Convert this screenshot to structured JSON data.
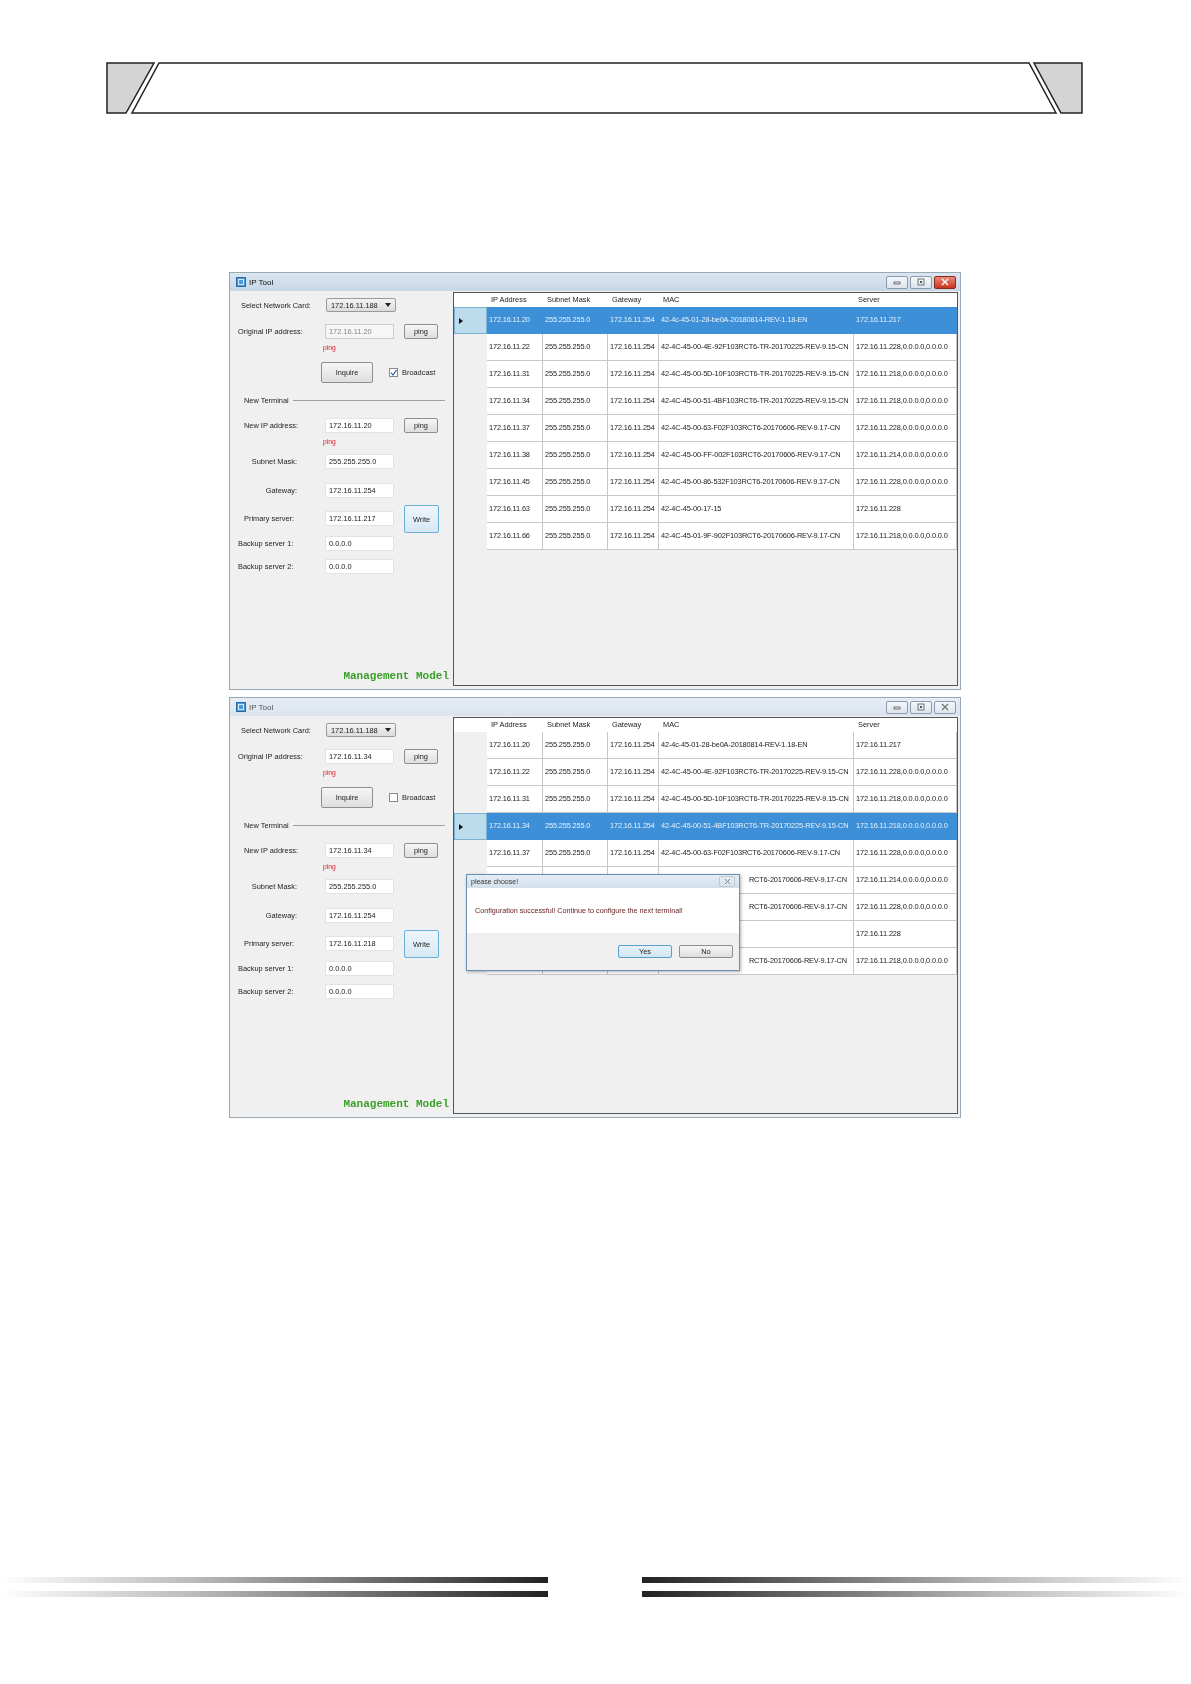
{
  "windows": [
    {
      "title": "IP Tool",
      "active": true,
      "network_card": {
        "label": "Select Network Card:",
        "value": "172.16.11.188"
      },
      "original_ip": {
        "label": "Original IP address:",
        "value": "172.16.11.20",
        "disabled": true,
        "button": "ping",
        "status": "ping"
      },
      "inquire_button": "Inquire",
      "broadcast": {
        "label": "Broadcast",
        "checked": true
      },
      "section_title": "New Terminal",
      "new_ip": {
        "label": "New IP address:",
        "value": "172.16.11.20",
        "button": "ping",
        "status": "ping"
      },
      "subnet": {
        "label": "Subnet Mask:",
        "value": "255.255.255.0"
      },
      "gateway": {
        "label": "Gateway:",
        "value": "172.16.11.254"
      },
      "primary": {
        "label": "Primary server:",
        "value": "172.16.11.217"
      },
      "write_button": "Write",
      "backup_1": {
        "label": "Backup server 1:",
        "value": "0.0.0.0"
      },
      "backup_2": {
        "label": "Backup server 2:",
        "value": "0.0.0.0"
      },
      "mode_label": "Management Model",
      "table": {
        "columns": [
          "IP Address",
          "Subnet Mask",
          "Gateway",
          "MAC",
          "Server"
        ],
        "rows": [
          {
            "selected": true,
            "cells": [
              "172.16.11.20",
              "255.255.255.0",
              "172.16.11.254",
              "42-4c-45-01-28-be0A-20180814-REV-1.18-EN",
              "172.16.11.217"
            ]
          },
          {
            "selected": false,
            "cells": [
              "172.16.11.22",
              "255.255.255.0",
              "172.16.11.254",
              "42-4C-45-00-4E-92F103RCT6-TR-20170225-REV-9.15-CN",
              "172.16.11.228,0.0.0.0,0.0.0.0"
            ]
          },
          {
            "selected": false,
            "cells": [
              "172.16.11.31",
              "255.255.255.0",
              "172.16.11.254",
              "42-4C-45-00-5D-10F103RCT6-TR-20170225-REV-9.15-CN",
              "172.16.11.218,0.0.0.0,0.0.0.0"
            ]
          },
          {
            "selected": false,
            "cells": [
              "172.16.11.34",
              "255.255.255.0",
              "172.16.11.254",
              "42-4C-45-00-51-4BF103RCT6-TR-20170225-REV-9.15-CN",
              "172.16.11.218,0.0.0.0,0.0.0.0"
            ]
          },
          {
            "selected": false,
            "cells": [
              "172.16.11.37",
              "255.255.255.0",
              "172.16.11.254",
              "42-4C-45-00-63-F02F103RCT6-20170606-REV-9.17-CN",
              "172.16.11.228,0.0.0.0,0.0.0.0"
            ]
          },
          {
            "selected": false,
            "cells": [
              "172.16.11.38",
              "255.255.255.0",
              "172.16.11.254",
              "42-4C-45-00-FF-002F103RCT6-20170606-REV-9.17-CN",
              "172.16.11.214,0.0.0.0,0.0.0.0"
            ]
          },
          {
            "selected": false,
            "cells": [
              "172.16.11.45",
              "255.255.255.0",
              "172.16.11.254",
              "42-4C-45-00-86-532F103RCT6-20170606-REV-9.17-CN",
              "172.16.11.228,0.0.0.0,0.0.0.0"
            ]
          },
          {
            "selected": false,
            "cells": [
              "172.16.11.63",
              "255.255.255.0",
              "172.16.11.254",
              "42-4C-45-00-17-15",
              "172.16.11.228"
            ]
          },
          {
            "selected": false,
            "cells": [
              "172.16.11.66",
              "255.255.255.0",
              "172.16.11.254",
              "42-4C-45-01-9F-902F103RCT6-20170606-REV-9.17-CN",
              "172.16.11.218,0.0.0.0,0.0.0.0"
            ]
          }
        ]
      }
    },
    {
      "title": "IP Tool",
      "active": false,
      "network_card": {
        "label": "Select Network Card:",
        "value": "172.16.11.188"
      },
      "original_ip": {
        "label": "Original IP address:",
        "value": "172.16.11.34",
        "disabled": false,
        "button": "ping",
        "status": "ping"
      },
      "inquire_button": "Inquire",
      "broadcast": {
        "label": "Broadcast",
        "checked": false
      },
      "section_title": "New Terminal",
      "new_ip": {
        "label": "New IP address:",
        "value": "172.16.11.34",
        "button": "ping",
        "status": "ping"
      },
      "subnet": {
        "label": "Subnet Mask:",
        "value": "255.255.255.0"
      },
      "gateway": {
        "label": "Gateway:",
        "value": "172.16.11.254"
      },
      "primary": {
        "label": "Primary server:",
        "value": "172.16.11.218"
      },
      "write_button": "Write",
      "backup_1": {
        "label": "Backup server 1:",
        "value": "0.0.0.0"
      },
      "backup_2": {
        "label": "Backup server 2:",
        "value": "0.0.0.0"
      },
      "mode_label": "Management Model",
      "table": {
        "columns": [
          "IP Address",
          "Subnet Mask",
          "Gateway",
          "MAC",
          "Server"
        ],
        "rows": [
          {
            "selected": false,
            "cells": [
              "172.16.11.20",
              "255.255.255.0",
              "172.16.11.254",
              "42-4c-45-01-28-be0A-20180814-REV-1.18-EN",
              "172.16.11.217"
            ]
          },
          {
            "selected": false,
            "cells": [
              "172.16.11.22",
              "255.255.255.0",
              "172.16.11.254",
              "42-4C-45-00-4E-92F103RCT6-TR-20170225-REV-9.15-CN",
              "172.16.11.228,0.0.0.0,0.0.0.0"
            ]
          },
          {
            "selected": false,
            "cells": [
              "172.16.11.31",
              "255.255.255.0",
              "172.16.11.254",
              "42-4C-45-00-5D-10F103RCT6-TR-20170225-REV-9.15-CN",
              "172.16.11.218,0.0.0.0,0.0.0.0"
            ]
          },
          {
            "selected": true,
            "cells": [
              "172.16.11.34",
              "255.255.255.0",
              "172.16.11.254",
              "42-4C-45-00-51-4BF103RCT6-TR-20170225-REV-9.15-CN",
              "172.16.11.218,0.0.0.0,0.0.0.0"
            ]
          },
          {
            "selected": false,
            "cells": [
              "172.16.11.37",
              "255.255.255.0",
              "172.16.11.254",
              "42-4C-45-00-63-F02F103RCT6-20170606-REV-9.17-CN",
              "172.16.11.228,0.0.0.0,0.0.0.0"
            ]
          },
          {
            "selected": false,
            "cells": [
              null,
              null,
              null,
              {
                "text": "RCT6-20170606-REV-9.17-CN",
                "covered": true
              },
              "172.16.11.214,0.0.0.0,0.0.0.0"
            ]
          },
          {
            "selected": false,
            "cells": [
              null,
              null,
              null,
              {
                "text": "RCT6-20170606-REV-9.17-CN",
                "covered": true
              },
              "172.16.11.228,0.0.0.0,0.0.0.0"
            ]
          },
          {
            "selected": false,
            "cells": [
              null,
              null,
              null,
              null,
              "172.16.11.228"
            ]
          },
          {
            "selected": false,
            "cells": [
              null,
              null,
              null,
              {
                "text": "RCT6-20170606-REV-9.17-CN",
                "covered": true
              },
              "172.16.11.218,0.0.0.0,0.0.0.0"
            ]
          }
        ]
      },
      "dialog": {
        "title": "please choose!",
        "message": "Configuration successful! Continue to configure the next terminal!",
        "buttons": [
          "Yes",
          "No"
        ]
      }
    }
  ]
}
